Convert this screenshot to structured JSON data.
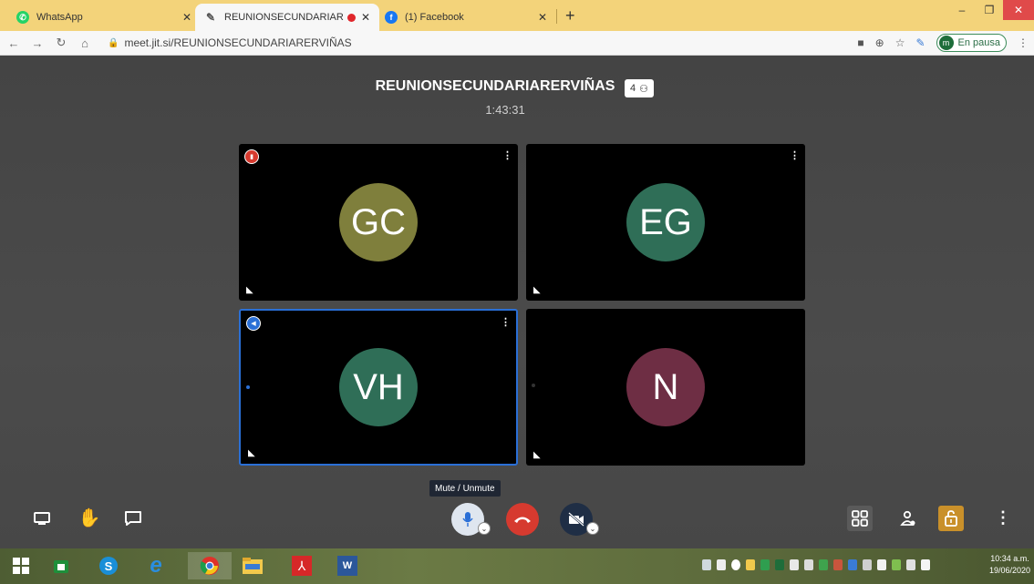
{
  "browser": {
    "tabs": [
      {
        "title": "WhatsApp",
        "icon": "whatsapp-icon",
        "color": "#25d366"
      },
      {
        "title": "REUNIONSECUNDARIARERVIÑAS",
        "icon": "jitsi-icon",
        "color": "#777777"
      },
      {
        "title": "(1) Facebook",
        "icon": "facebook-icon",
        "color": "#1877f2"
      }
    ],
    "new_tab": "+",
    "url": "meet.jit.si/REUNIONSECUNDARIARERVIÑAS",
    "profile": {
      "initial": "m",
      "label": "En pausa"
    }
  },
  "meeting": {
    "room_name": "REUNIONSECUNDARIARERVIÑAS",
    "participant_count": "4",
    "elapsed": "1:43:31",
    "participants": [
      {
        "initials": "GC",
        "color": "#7f7f3c",
        "badge_color": "#d63a2f",
        "active": false
      },
      {
        "initials": "EG",
        "color": "#2f6e57",
        "badge_color": "",
        "active": false
      },
      {
        "initials": "VH",
        "color": "#2f6e57",
        "badge_color": "#2a6fd6",
        "active": true
      },
      {
        "initials": "N",
        "color": "#6e2e44",
        "badge_color": "",
        "active": false
      }
    ]
  },
  "toolbar": {
    "tooltip": "Mute / Unmute",
    "hangup_color": "#d63a2f",
    "security_color": "#c9902a"
  },
  "taskbar": {
    "time": "10:34 a.m.",
    "date": "19/06/2020"
  }
}
